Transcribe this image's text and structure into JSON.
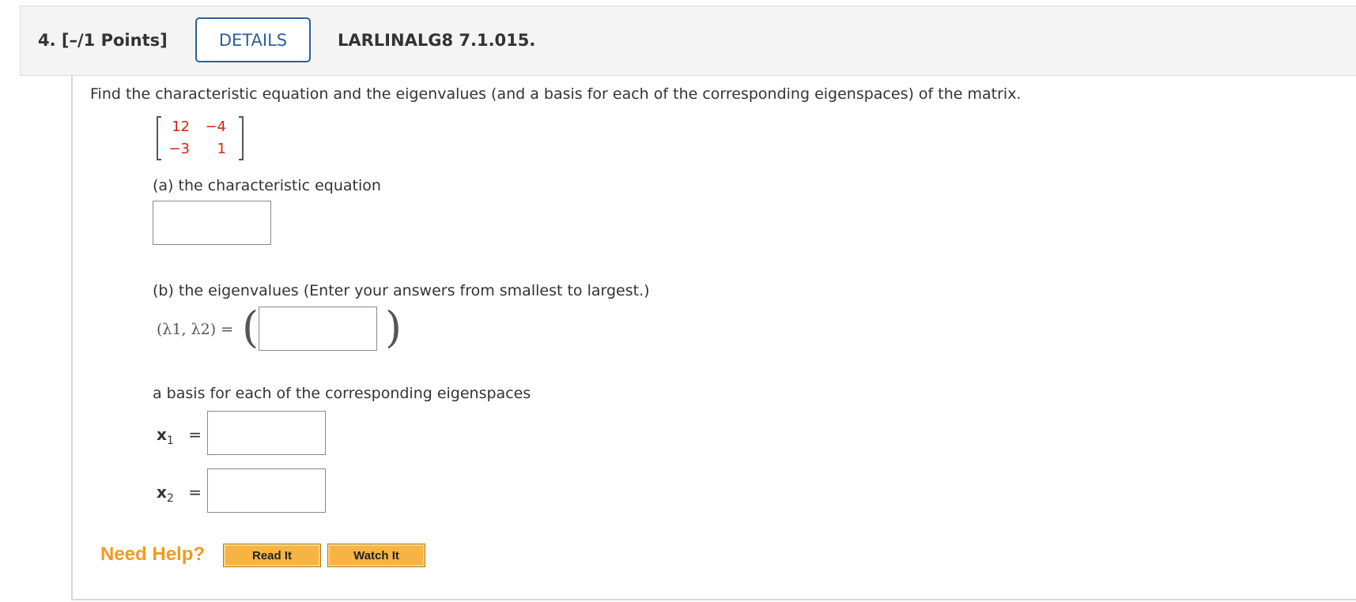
{
  "question": {
    "number": "4.",
    "points": "[–/1 Points]",
    "details_label": "DETAILS",
    "code": "LARLINALG8 7.1.015."
  },
  "prompt": "Find the characteristic equation and the eigenvalues (and a basis for each of the corresponding eigenspaces) of the matrix.",
  "matrix": {
    "rows": [
      [
        "12",
        "−4"
      ],
      [
        "−3",
        "1"
      ]
    ]
  },
  "part_a": {
    "label": "(a) the characteristic equation",
    "value": ""
  },
  "part_b": {
    "label": "(b) the eigenvalues (Enter your answers from smallest to largest.)",
    "lhs": "(λ1, λ2) =",
    "value": ""
  },
  "basis": {
    "label": "a basis for each of the corresponding eigenspaces",
    "x1_label": "x",
    "x1_sub": "1",
    "x2_label": "x",
    "x2_sub": "2",
    "eq": "=",
    "x1_value": "",
    "x2_value": ""
  },
  "help": {
    "label": "Need Help?",
    "read_it": "Read It",
    "watch_it": "Watch It"
  },
  "colors": {
    "accent_blue": "#2b6196",
    "matrix_red": "#d9230f",
    "help_orange": "#f39a1d",
    "button_gold": "#f7b442"
  }
}
